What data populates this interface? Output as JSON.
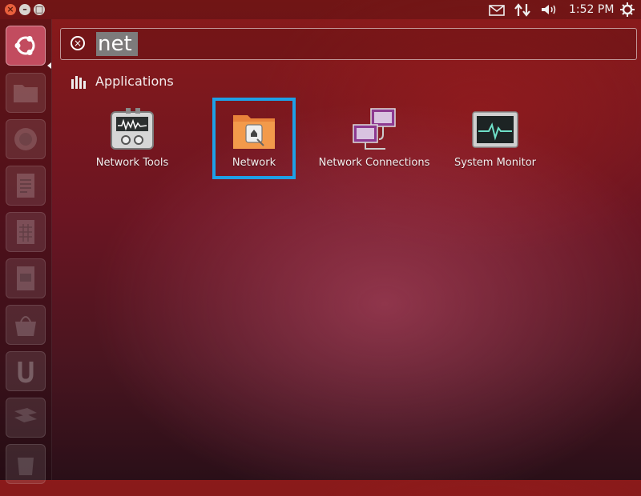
{
  "top_panel": {
    "window_buttons": {
      "close": "×",
      "minimize": "–",
      "maximize": "□"
    },
    "icons": {
      "mail": "mail-icon",
      "network": "network-updown-icon",
      "volume": "volume-icon",
      "session": "gear-icon"
    },
    "clock": "1:52 PM"
  },
  "launcher": {
    "items": [
      {
        "name": "dash-home",
        "icon": "ubuntu-logo-icon"
      },
      {
        "name": "files",
        "icon": "folder-icon"
      },
      {
        "name": "firefox",
        "icon": "firefox-icon"
      },
      {
        "name": "libreoffice-writer",
        "icon": "writer-icon"
      },
      {
        "name": "libreoffice-calc",
        "icon": "calc-icon"
      },
      {
        "name": "libreoffice-impress",
        "icon": "impress-icon"
      },
      {
        "name": "software-center",
        "icon": "software-center-icon"
      },
      {
        "name": "ubuntu-one",
        "icon": "ubuntu-one-icon"
      },
      {
        "name": "workspaces",
        "icon": "workspace-switcher-icon"
      },
      {
        "name": "trash",
        "icon": "trash-icon"
      }
    ]
  },
  "search": {
    "value": "net"
  },
  "applications": {
    "title": "Applications",
    "items": [
      {
        "label": "Network Tools",
        "icon": "network-tools-icon"
      },
      {
        "label": "Network",
        "icon": "network-folder-icon",
        "selected": true
      },
      {
        "label": "Network Connections",
        "icon": "network-connections-icon"
      },
      {
        "label": "System Monitor",
        "icon": "system-monitor-icon"
      }
    ]
  },
  "colors": {
    "selection": "#1ea0e6",
    "dash_home": "#c24c5f",
    "background": "#7a1c22"
  }
}
